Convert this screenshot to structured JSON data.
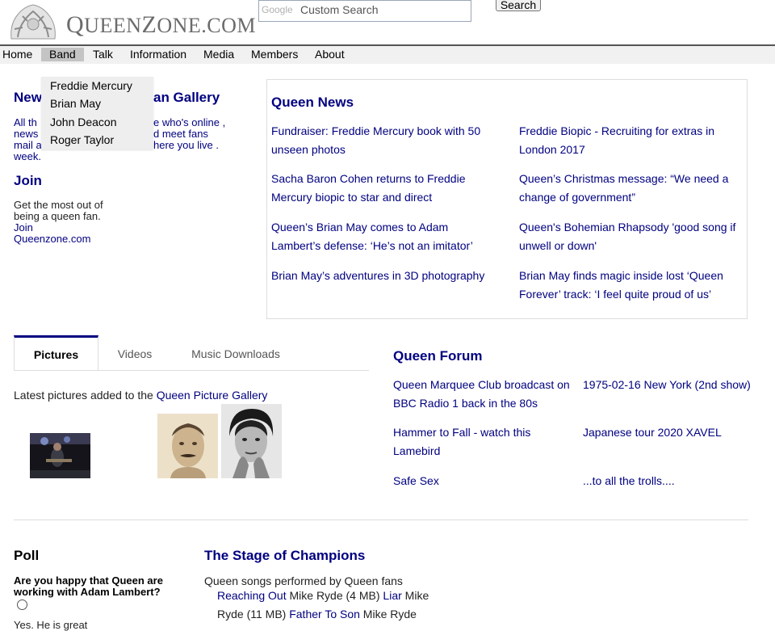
{
  "site": {
    "logo_text": "QueenZone.com"
  },
  "search": {
    "google_label": "Google",
    "placeholder": "Custom Search",
    "button": "Search"
  },
  "nav": {
    "items": [
      "Home",
      "Band",
      "Talk",
      "Information",
      "Media",
      "Members",
      "About"
    ],
    "active": "Band",
    "band_dropdown": [
      "Freddie Mercury",
      "Brian May",
      "John Deacon",
      "Roger Taylor"
    ]
  },
  "left": {
    "news_heading_visible": "New",
    "gallery_heading_visible": "an Gallery",
    "intro_line1_left": "All th",
    "intro_line1_right": "e who's online ,",
    "intro_line2_left": "news",
    "intro_line2_right": "d meet fans",
    "intro_line3_left": "mail a",
    "intro_line3_right": "here you live .",
    "intro_line4_left": "week.",
    "join_heading": "Join",
    "join_text": "Get the most out of being a queen fan.",
    "join_link": "Join Queenzone.com"
  },
  "news": {
    "title": "Queen News",
    "items": [
      "Fundraiser: Freddie Mercury book with 50 unseen photos",
      "Freddie Biopic - Recruiting for extras in London 2017",
      "Sacha Baron Cohen returns to Freddie Mercury biopic to star and direct",
      "Queen’s Christmas message: “We need a change of government”",
      "Queen’s Brian May comes to Adam Lambert’s defense: ‘He’s not an imitator’",
      "Queen's Bohemian Rhapsody 'good song if unwell or down'",
      "Brian May’s adventures in 3D photography",
      "Brian May finds magic inside lost ‘Queen Forever’ track: ‘I feel quite proud of us’"
    ]
  },
  "media_tabs": {
    "tabs": [
      "Pictures",
      "Videos",
      "Music Downloads"
    ],
    "active": "Pictures",
    "latest_prefix": "Latest pictures added to the",
    "latest_link": "Queen Picture Gallery"
  },
  "forum": {
    "title": "Queen Forum",
    "items": [
      "Queen Marquee Club broadcast on BBC Radio 1 back in the 80s",
      "1975-02-16 New York (2nd show)",
      "Hammer to Fall - watch this Lamebird",
      "Japanese tour 2020 XAVEL",
      "Safe Sex",
      "...to all the trolls...."
    ]
  },
  "poll": {
    "title": "Poll",
    "question": "Are you happy that Queen are working with Adam Lambert?",
    "option1": "Yes. He is great"
  },
  "stage": {
    "title": "The Stage of Champions",
    "intro": "Queen songs performed by Queen fans",
    "songs": [
      {
        "song": "Reaching Out",
        "performer": "Mike Ryde (4 MB)"
      },
      {
        "song": "Liar",
        "performer": "Mike Ryde (11 MB)"
      },
      {
        "song": "Father To Son",
        "performer": "Mike Ryde"
      }
    ]
  },
  "colors": {
    "link": "#000080",
    "nav_bg": "#f1f1f1",
    "nav_active": "#c4c4c4",
    "border": "#dddddd"
  }
}
